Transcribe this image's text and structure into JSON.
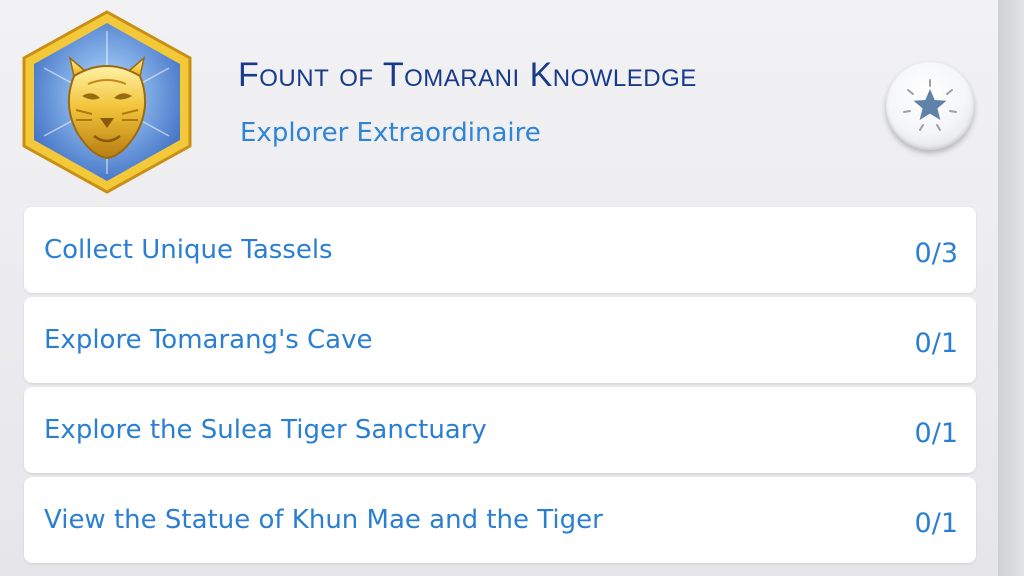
{
  "aspiration": {
    "title": "Fount of Tomarani Knowledge",
    "subtitle": "Explorer Extraordinaire",
    "badge_icon": "golden-tiger-head-icon",
    "action_icon": "star-icon"
  },
  "tasks": [
    {
      "label": "Collect Unique Tassels",
      "progress": "0/3"
    },
    {
      "label": "Explore Tomarang's Cave",
      "progress": "0/1"
    },
    {
      "label": "Explore the Sulea Tiger Sanctuary",
      "progress": "0/1"
    },
    {
      "label": "View the Statue of Khun Mae and the Tiger",
      "progress": "0/1"
    }
  ],
  "colors": {
    "title": "#173a8a",
    "accent": "#2b7fd3",
    "badge_frame": "#f1c232",
    "badge_bg": "#5b8fd6"
  }
}
